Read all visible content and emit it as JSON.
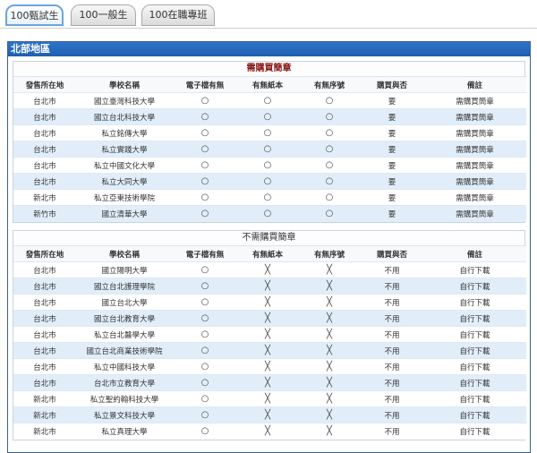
{
  "tabs": [
    {
      "label": "100甄試生",
      "active": true
    },
    {
      "label": "100一般生",
      "active": false
    },
    {
      "label": "100在職專班",
      "active": false
    }
  ],
  "region_title": "北部地區",
  "columns": [
    "發售所在地",
    "學校名稱",
    "電子檔有無",
    "有無紙本",
    "有無序號",
    "購買與否",
    "備註"
  ],
  "sections": [
    {
      "title": "需購買簡章",
      "rows": [
        [
          "台北市",
          "國立臺灣科技大學",
          "○",
          "○",
          "○",
          "要",
          "需購買簡章"
        ],
        [
          "台北市",
          "國立台北科技大學",
          "○",
          "○",
          "○",
          "要",
          "需購買簡章"
        ],
        [
          "台北市",
          "私立銘傳大學",
          "○",
          "○",
          "○",
          "要",
          "需購買簡章"
        ],
        [
          "台北市",
          "私立實踐大學",
          "○",
          "○",
          "○",
          "要",
          "需購買簡章"
        ],
        [
          "台北市",
          "私立中國文化大學",
          "○",
          "○",
          "○",
          "要",
          "需購買簡章"
        ],
        [
          "台北市",
          "私立大同大學",
          "○",
          "○",
          "○",
          "要",
          "需購買簡章"
        ],
        [
          "新北市",
          "私立亞東技術學院",
          "○",
          "○",
          "○",
          "要",
          "需購買簡章"
        ],
        [
          "新竹市",
          "國立清華大學",
          "○",
          "○",
          "○",
          "要",
          "需購買簡章"
        ]
      ]
    },
    {
      "title": "不需購買簡章",
      "rows": [
        [
          "台北市",
          "國立陽明大學",
          "○",
          "╳",
          "╳",
          "不用",
          "自行下載"
        ],
        [
          "台北市",
          "國立台北護理學院",
          "○",
          "╳",
          "╳",
          "不用",
          "自行下載"
        ],
        [
          "台北市",
          "國立台北大學",
          "○",
          "╳",
          "╳",
          "不用",
          "自行下載"
        ],
        [
          "台北市",
          "國立台北教育大學",
          "○",
          "╳",
          "╳",
          "不用",
          "自行下載"
        ],
        [
          "台北市",
          "私立台北醫學大學",
          "○",
          "╳",
          "╳",
          "不用",
          "自行下載"
        ],
        [
          "台北市",
          "國立台北商業技術學院",
          "○",
          "╳",
          "╳",
          "不用",
          "自行下載"
        ],
        [
          "台北市",
          "私立中國科技大學",
          "○",
          "╳",
          "╳",
          "不用",
          "自行下載"
        ],
        [
          "台北市",
          "台北市立教育大學",
          "○",
          "╳",
          "╳",
          "不用",
          "自行下載"
        ],
        [
          "新北市",
          "私立聖約翰科技大學",
          "○",
          "╳",
          "╳",
          "不用",
          "自行下載"
        ],
        [
          "新北市",
          "私立景文科技大學",
          "○",
          "╳",
          "╳",
          "不用",
          "自行下載"
        ],
        [
          "新北市",
          "私立真理大學",
          "○",
          "╳",
          "╳",
          "不用",
          "自行下載"
        ]
      ]
    }
  ]
}
